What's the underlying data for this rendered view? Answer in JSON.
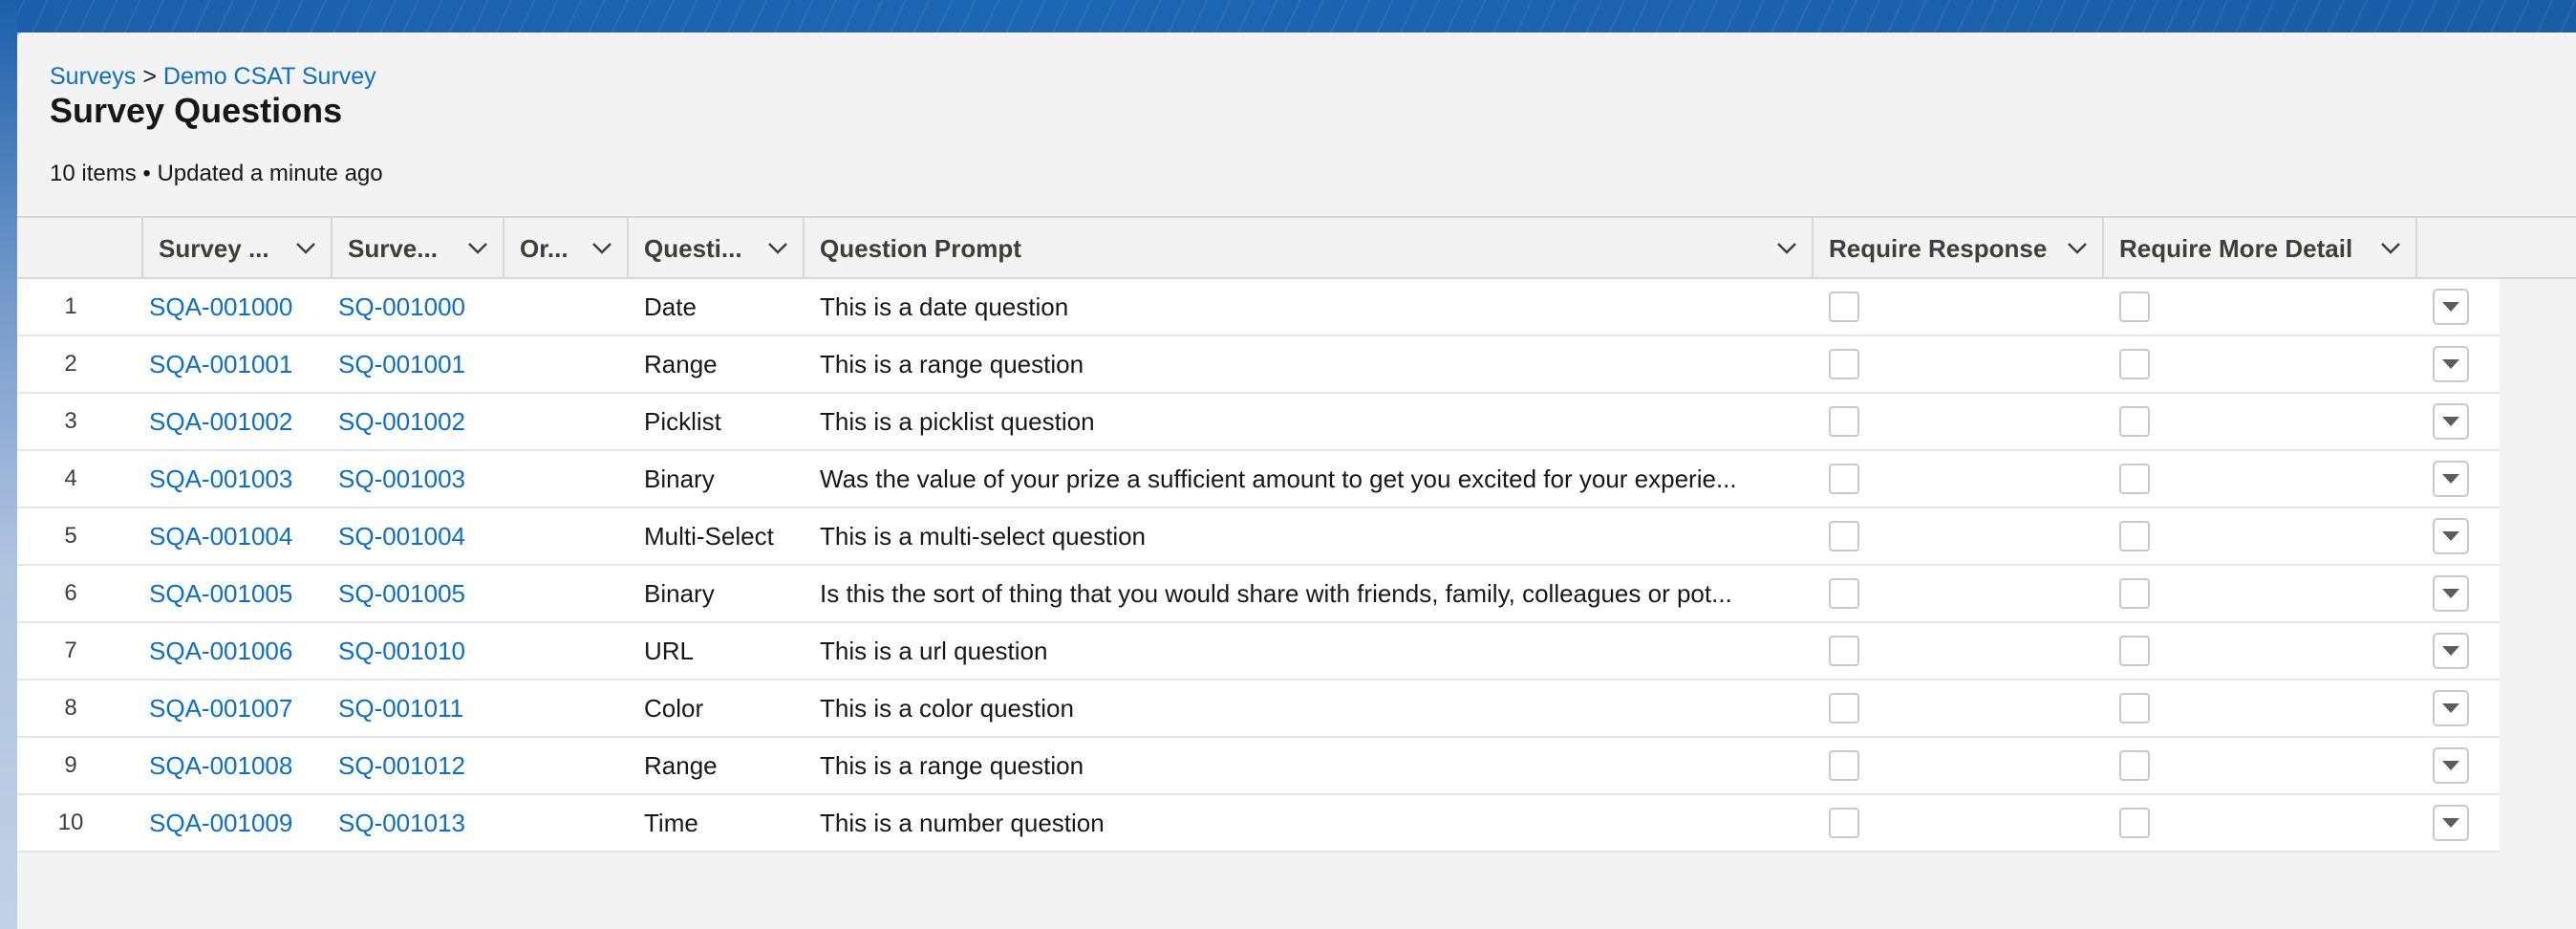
{
  "breadcrumb": {
    "parent": "Surveys",
    "separator": ">",
    "current": "Demo CSAT Survey"
  },
  "page": {
    "title": "Survey Questions",
    "meta": "10 items • Updated a minute ago"
  },
  "table": {
    "columns": [
      {
        "label": "Survey ..."
      },
      {
        "label": "Surve..."
      },
      {
        "label": "Or..."
      },
      {
        "label": "Questi..."
      },
      {
        "label": "Question Prompt"
      },
      {
        "label": "Require Response"
      },
      {
        "label": "Require More Detail"
      }
    ],
    "rows": [
      {
        "n": "1",
        "survey_answer": "SQA-001000",
        "survey_question": "SQ-001000",
        "order": "",
        "type": "Date",
        "prompt": "This is a date question",
        "require_response": false,
        "require_more_detail": false
      },
      {
        "n": "2",
        "survey_answer": "SQA-001001",
        "survey_question": "SQ-001001",
        "order": "",
        "type": "Range",
        "prompt": "This is a range question",
        "require_response": false,
        "require_more_detail": false
      },
      {
        "n": "3",
        "survey_answer": "SQA-001002",
        "survey_question": "SQ-001002",
        "order": "",
        "type": "Picklist",
        "prompt": "This is a picklist question",
        "require_response": false,
        "require_more_detail": false
      },
      {
        "n": "4",
        "survey_answer": "SQA-001003",
        "survey_question": "SQ-001003",
        "order": "",
        "type": "Binary",
        "prompt": "Was the value of your prize a sufficient amount to get you excited for your experie...",
        "require_response": false,
        "require_more_detail": false
      },
      {
        "n": "5",
        "survey_answer": "SQA-001004",
        "survey_question": "SQ-001004",
        "order": "",
        "type": "Multi-Select",
        "prompt": "This is a multi-select question",
        "require_response": false,
        "require_more_detail": false
      },
      {
        "n": "6",
        "survey_answer": "SQA-001005",
        "survey_question": "SQ-001005",
        "order": "",
        "type": "Binary",
        "prompt": "Is this the sort of thing that you would share with friends, family, colleagues or pot...",
        "require_response": false,
        "require_more_detail": false
      },
      {
        "n": "7",
        "survey_answer": "SQA-001006",
        "survey_question": "SQ-001010",
        "order": "",
        "type": "URL",
        "prompt": "This is a url question",
        "require_response": false,
        "require_more_detail": false
      },
      {
        "n": "8",
        "survey_answer": "SQA-001007",
        "survey_question": "SQ-001011",
        "order": "",
        "type": "Color",
        "prompt": "This is a color question",
        "require_response": false,
        "require_more_detail": false
      },
      {
        "n": "9",
        "survey_answer": "SQA-001008",
        "survey_question": "SQ-001012",
        "order": "",
        "type": "Range",
        "prompt": "This is a range question",
        "require_response": false,
        "require_more_detail": false
      },
      {
        "n": "10",
        "survey_answer": "SQA-001009",
        "survey_question": "SQ-001013",
        "order": "",
        "type": "Time",
        "prompt": "This is a number question",
        "require_response": false,
        "require_more_detail": false
      }
    ]
  },
  "icons": {
    "column_sort": "chevron-down-icon",
    "row_actions": "caret-down-icon"
  },
  "colors": {
    "link": "#0b6fc9",
    "header_band": "#1b5faa",
    "panel": "#f3f3f3"
  }
}
